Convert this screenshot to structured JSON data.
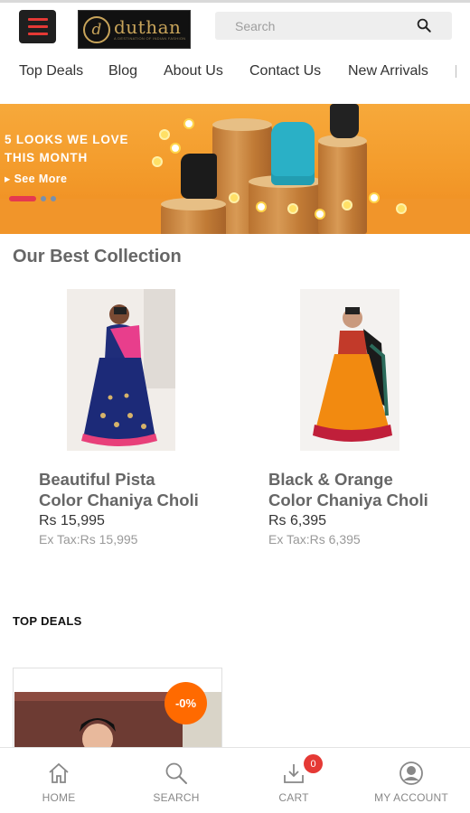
{
  "header": {
    "logo_name": "duthan",
    "logo_initial": "d",
    "logo_tagline": "A DESTINATION OF INDIAN FASHION",
    "search_placeholder": "Search"
  },
  "nav": {
    "items": [
      "Top Deals",
      "Blog",
      "About Us",
      "Contact Us",
      "New Arrivals"
    ]
  },
  "banner": {
    "headline_line1": "5 LOOKS WE LOVE",
    "headline_line2": "THIS MONTH",
    "cta": "See More",
    "slide_count": 3,
    "active_slide": 1
  },
  "best_collection": {
    "title": "Our Best Collection",
    "products": [
      {
        "name_line1": "Beautiful Pista",
        "name_line2": "Color Chaniya Choli",
        "price": "Rs 15,995",
        "ex_tax": "Ex Tax:Rs 15,995"
      },
      {
        "name_line1": "Black & Orange",
        "name_line2": "Color Chaniya Choli",
        "price": "Rs 6,395",
        "ex_tax": "Ex Tax:Rs 6,395"
      }
    ]
  },
  "top_deals": {
    "title": "TOP DEALS",
    "discount_badge": "-0%"
  },
  "bottom_nav": {
    "home": "HOME",
    "search": "SEARCH",
    "cart": "CART",
    "cart_count": "0",
    "account": "MY ACCOUNT"
  },
  "colors": {
    "accent_red": "#e53935",
    "banner_orange": "#f39a2a",
    "discount_orange": "#ff6a00",
    "logo_gold": "#c8a45a"
  }
}
